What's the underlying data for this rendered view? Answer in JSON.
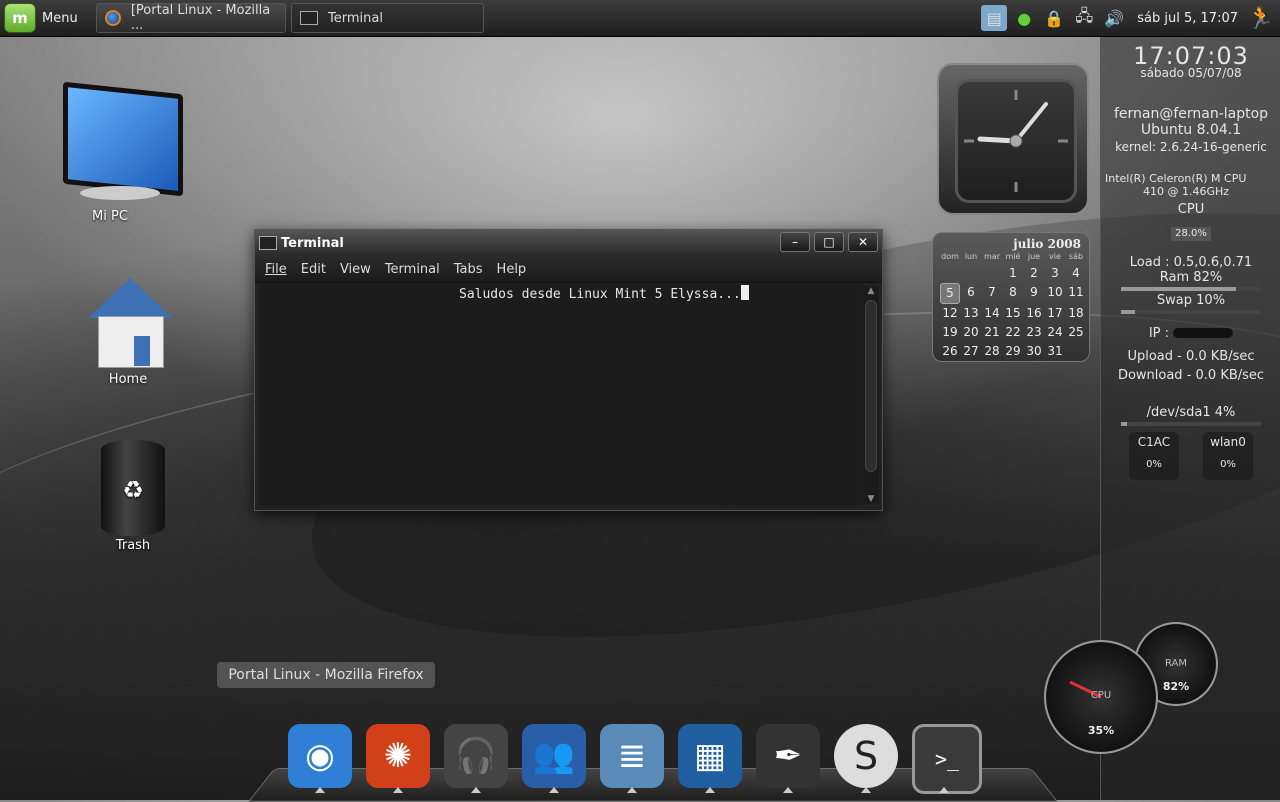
{
  "panel": {
    "menu_label": "Menu",
    "tasks": [
      {
        "label": "[Portal Linux - Mozilla ..."
      },
      {
        "label": "Terminal"
      }
    ],
    "datetime": "sáb jul  5, 17:07"
  },
  "desktop": {
    "icons": [
      {
        "label": "Mi PC"
      },
      {
        "label": "Home"
      },
      {
        "label": "Trash"
      }
    ]
  },
  "terminal": {
    "title": "Terminal",
    "menu": [
      "File",
      "Edit",
      "View",
      "Terminal",
      "Tabs",
      "Help"
    ],
    "text": "Saludos desde Linux Mint 5 Elyssa..."
  },
  "calendar": {
    "month": "julio 2008",
    "day_names": [
      "dom",
      "lun",
      "mar",
      "mié",
      "jue",
      "vie",
      "sáb"
    ],
    "days": [
      "",
      "",
      "",
      "1",
      "2",
      "3",
      "4",
      "5",
      "6",
      "7",
      "8",
      "9",
      "10",
      "11",
      "12",
      "13",
      "14",
      "15",
      "16",
      "17",
      "18",
      "19",
      "20",
      "21",
      "22",
      "23",
      "24",
      "25",
      "26",
      "27",
      "28",
      "29",
      "30",
      "31"
    ],
    "today": "5"
  },
  "conky": {
    "time": "17:07:03",
    "date": "sábado 05/07/08",
    "user": "fernan@fernan-laptop",
    "os": "Ubuntu 8.04.1",
    "kernel": "kernel: 2.6.24-16-generic",
    "cpu_model_1": "Intel(R) Celeron(R) M CPU",
    "cpu_model_2": "410  @ 1.46GHz",
    "cpu_label": "CPU",
    "cpu_pct": "28.0%",
    "load": "Load : 0.5,0.6,0.71",
    "ram": "Ram 82%",
    "swap": "Swap 10%",
    "ram_level": 82,
    "swap_level": 10,
    "ip_label": "IP :",
    "upload": "Upload - 0.0 KB/sec",
    "download": "Download - 0.0 KB/sec",
    "disk": "/dev/sda1 4%",
    "disk_level": 4,
    "batt_label": "C1AC",
    "batt_pct": "0%",
    "wlan_label": "wlan0",
    "wlan_pct": "0%"
  },
  "gauges": {
    "cpu_label": "CPU",
    "cpu_value": "35%",
    "ram_label": "RAM",
    "ram_value": "82%"
  },
  "tooltip": "Portal Linux - Mozilla Firefox",
  "dock": [
    {
      "name": "dock-firefox-icon",
      "glyph": "◉",
      "color": "#2f7fd6"
    },
    {
      "name": "dock-burner-icon",
      "glyph": "✺",
      "color": "#d2401a"
    },
    {
      "name": "dock-headphones-icon",
      "glyph": "🎧",
      "color": "#444444"
    },
    {
      "name": "dock-messenger-icon",
      "glyph": "👥",
      "color": "#2a5ea8"
    },
    {
      "name": "dock-files-icon",
      "glyph": "≣",
      "color": "#5a8bb8"
    },
    {
      "name": "dock-video-icon",
      "glyph": "▦",
      "color": "#1f5fa0"
    },
    {
      "name": "dock-writer-icon",
      "glyph": "✒",
      "color": "#333333"
    },
    {
      "name": "dock-skype-icon",
      "glyph": "S",
      "color": "#dddddd"
    },
    {
      "name": "dock-terminal-icon",
      "glyph": ">_",
      "color": "#3a3a3a"
    }
  ]
}
